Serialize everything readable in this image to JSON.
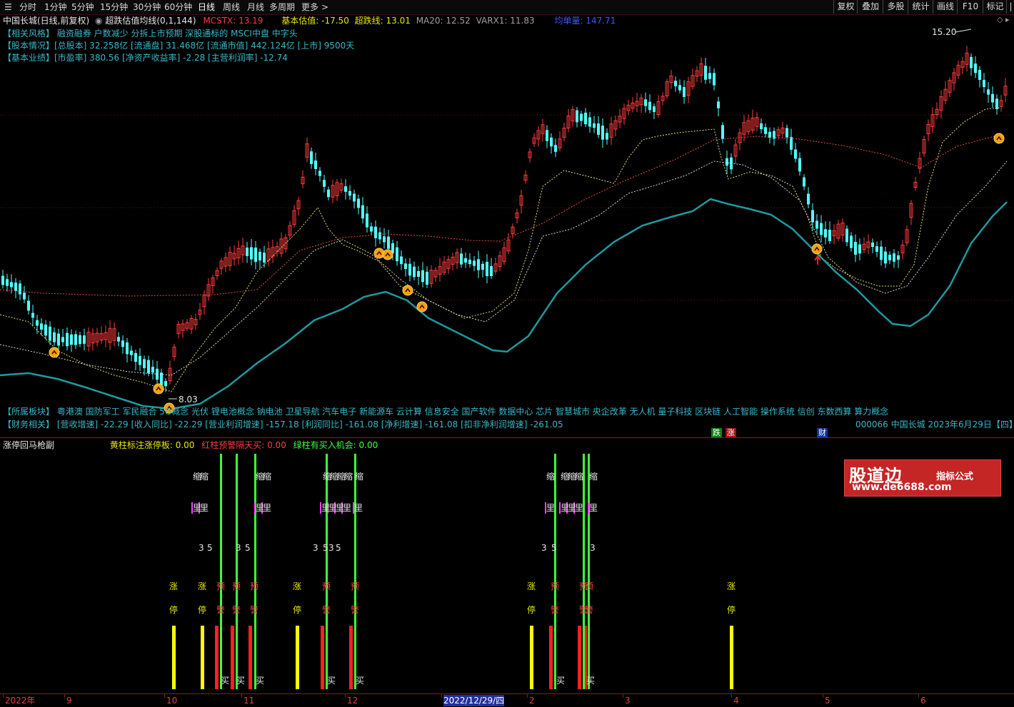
{
  "toolbar": {
    "periods": [
      "分时",
      "1分钟",
      "5分钟",
      "15分钟",
      "30分钟",
      "60分钟",
      "日线",
      "周线",
      "月线",
      "多周期",
      "更多"
    ],
    "right_buttons": [
      "复权",
      "叠加",
      "多股",
      "统计",
      "画线",
      "F10",
      "标记"
    ]
  },
  "header": {
    "title": "中国长城(日线,前复权)",
    "indicator": "超跌估值均线(0,1,144)",
    "mcstx": "MCSTX: 13.19",
    "base_value": "基本估值: -17.50",
    "oversold": "超跌线: 13.01",
    "ma20": "MA20: 12.52",
    "varx1": "VARX1: 11.83",
    "avg_price": "均单量: 147.71"
  },
  "info": {
    "style": "【相关风格】 融资融券 户数减少 分拆上市预期 深股通标的 MSCI中盘 中字头",
    "capital": "【股本情况】[总股本] 32.258亿 [流通盘] 31.468亿 [流通市值] 442.124亿 [上市] 9500天",
    "perf": "【基本业绩】[市盈率] 380.56 [净资产收益率] -2.28 [主营利润率] -12.74",
    "sector": "【所属板块】 粤港澳 国防军工 军民融合 5G概念 光伏 锂电池概念 钠电池 卫星导航 汽车电子 新能源车 云计算 信息安全 国产软件 数据中心 芯片 智慧城市 央企改革 无人机 量子科技 区块链 人工智能 操作系统 信创 东数西算 算力概念",
    "finance": "【财务相关】 [营收增速] -22.29 [收入同比] -22.29 [营业利润增速] -157.18 [利润同比] -161.08 [净利增速] -161.08 [扣非净利润增速] -261.05",
    "code_date": "000066 中国长城 2023年6月29日【四】"
  },
  "annotations": {
    "high": "15.20",
    "low": "8.03",
    "die": "跌",
    "zhang": "涨",
    "cai": "财",
    "buy": "买",
    "zhang_char": "涨",
    "ting_char": "停",
    "suo": "缩",
    "li": "里",
    "yu": "预",
    "jing": "警",
    "three": "3",
    "five": "5"
  },
  "sub": {
    "title": "涨停回马枪副",
    "yellow": "黄柱标注涨停板: 0.00",
    "red": "红柱预警隔天买: 0.00",
    "green": "绿柱有买入机会: 0.00"
  },
  "logo": {
    "line1": "股道边",
    "line2": "指标公式",
    "line3": "www.de6688.com"
  },
  "axis": {
    "labels": [
      "2022年",
      "9",
      "10",
      "11",
      "12",
      "2022/12/29/四",
      "2",
      "3",
      "4",
      "5",
      "6"
    ]
  },
  "colors": {
    "up": "#ff3c3c",
    "down": "#54ffff",
    "yellow": "#ffff00",
    "green": "#3cff3c",
    "teal": "#1e9aa0"
  }
}
